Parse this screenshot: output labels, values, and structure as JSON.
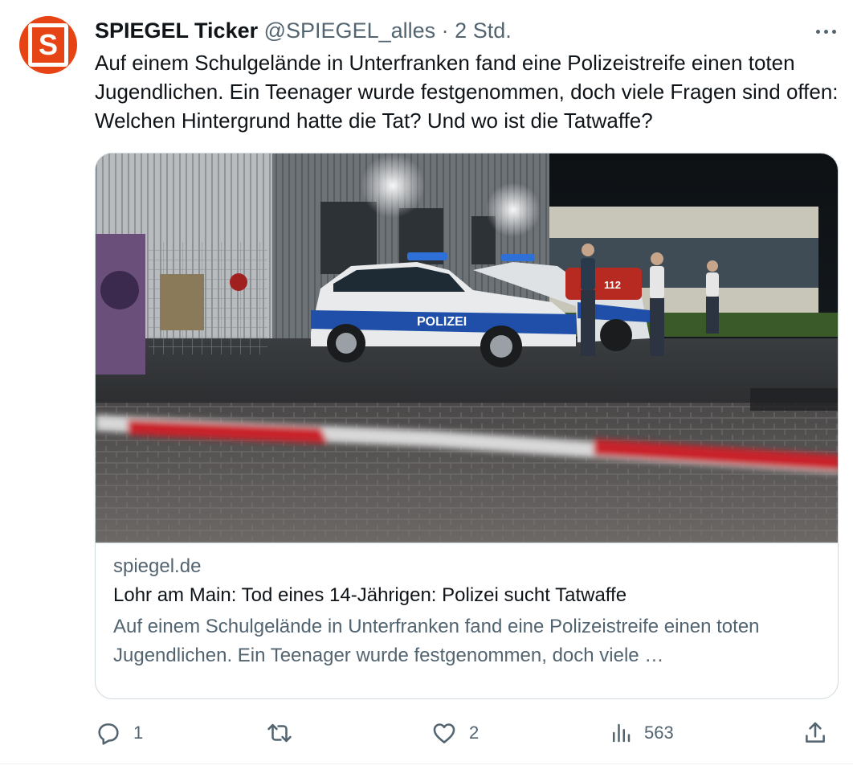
{
  "author": {
    "name": "SPIEGEL Ticker",
    "handle": "@SPIEGEL_alles",
    "separator": "·",
    "time": "2 Std.",
    "avatar_letter": "S",
    "avatar_color": "#e64415"
  },
  "more_icon": "more-horizontal-icon",
  "tweet_text": "Auf einem Schulgelände in Unterfranken fand eine Polizeistreife einen toten Jugendlichen. Ein Teenager wurde festgenommen, doch viele Fragen sind offen: Welchen Hintergrund hatte die Tat? Und wo ist die Tatwaffe?",
  "card": {
    "domain": "spiegel.de",
    "title": "Lohr am Main: Tod eines 14-Jährigen: Polizei sucht Tatwaffe",
    "description": "Auf einem Schulgelände in Unterfranken fand eine Polizeistreife einen toten Jugendlichen. Ein Teenager wurde festgenommen, doch viele …",
    "image_text": {
      "car_label": "POLIZEI",
      "van_label": "112"
    }
  },
  "actions": {
    "reply": {
      "icon": "reply-icon",
      "count": "1"
    },
    "retweet": {
      "icon": "retweet-icon",
      "count": ""
    },
    "like": {
      "icon": "heart-icon",
      "count": "2"
    },
    "views": {
      "icon": "views-icon",
      "count": "563"
    },
    "share": {
      "icon": "share-icon",
      "count": ""
    }
  },
  "colors": {
    "text_primary": "#0f1419",
    "text_secondary": "#536471",
    "border": "#cfd9de"
  }
}
